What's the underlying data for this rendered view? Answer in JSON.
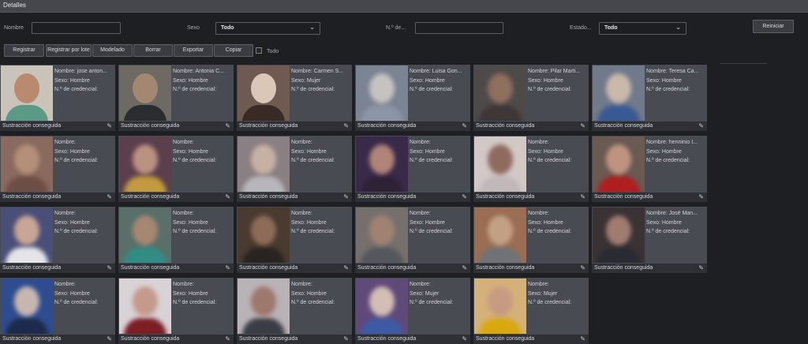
{
  "window": {
    "title": "Detalles"
  },
  "filters": {
    "name_label": "Nombre",
    "sex_label": "Sexo",
    "sex_value": "Todo",
    "credential_label": "N.º de...",
    "state_label": "Estado...",
    "state_value": "Todo",
    "reset_label": "Reiniciar"
  },
  "toolbar": {
    "register": "Registrar",
    "batch_register": "Registrar por lote",
    "modeling": "Modelado",
    "delete": "Borrar",
    "export": "Exportar",
    "copy": "Copiar",
    "all": "Todo"
  },
  "cards": [
    {
      "name": "Nombre: jose anton...",
      "sex": "Sexo: Hombre",
      "cred": "N.º de credencial:",
      "status": "Sustracción conseguida",
      "bg": "#c9c3ba",
      "face": "#b98a6e",
      "body": "#5b9a86",
      "blur": false
    },
    {
      "name": "Nombre: Antonia C...",
      "sex": "Sexo: Hombre",
      "cred": "N.º de credencial:",
      "status": "Sustracción conseguida",
      "bg": "#6d6a64",
      "face": "#a48770",
      "body": "#2a2c30",
      "blur": false
    },
    {
      "name": "Nombre: Carmen S...",
      "sex": "Sexo: Mujer",
      "cred": "N.º de credencial:",
      "status": "Sustracción conseguida",
      "bg": "#6e5a50",
      "face": "#d9c7b9",
      "body": "#3a2a26",
      "blur": false
    },
    {
      "name": "Nombre: Luisa Gon...",
      "sex": "Sexo: Hombre",
      "cred": "N.º de credencial:",
      "status": "Sustracción conseguida",
      "bg": "#7b8493",
      "face": "#c6c2c0",
      "body": "#8c95a5",
      "blur": true
    },
    {
      "name": "Nombre: Pilar Marti...",
      "sex": "Sexo: Hombre",
      "cred": "N.º de credencial:",
      "status": "Sustracción conseguida",
      "bg": "#4f4a4a",
      "face": "#8f6f5e",
      "body": "#3f3636",
      "blur": true
    },
    {
      "name": "Nombre: Teresa Ca...",
      "sex": "Sexo: Hombre",
      "cred": "N.º de credencial:",
      "status": "Sustracción conseguida",
      "bg": "#707a8a",
      "face": "#c9b9aa",
      "body": "#385a94",
      "blur": true
    },
    {
      "name": "Nombre:",
      "sex": "Sexo: Hombre",
      "cred": "N.º de credencial:",
      "status": "Sustracción conseguida",
      "bg": "#8a6a5e",
      "face": "#b48f7a",
      "body": "#6d4e46",
      "blur": true
    },
    {
      "name": "Nombre:",
      "sex": "Sexo: Hombre",
      "cred": "N.º de credencial:",
      "status": "Sustracción conseguida",
      "bg": "#5b3f4d",
      "face": "#bb9182",
      "body": "#c39a3d",
      "blur": true
    },
    {
      "name": "Nombre:",
      "sex": "Sexo: Hombre",
      "cred": "N.º de credencial:",
      "status": "Sustracción conseguida",
      "bg": "#8a7f82",
      "face": "#c7b1a4",
      "body": "#b7b6bb",
      "blur": true
    },
    {
      "name": "Nombre:",
      "sex": "Sexo: Hombre",
      "cred": "N.º de credencial:",
      "status": "Sustracción conseguida",
      "bg": "#3a2a4a",
      "face": "#b08478",
      "body": "#2d2236",
      "blur": true
    },
    {
      "name": "Nombre:",
      "sex": "Sexo: Hombre",
      "cred": "N.º de credencial:",
      "status": "Sustracción conseguida",
      "bg": "#d2c9c6",
      "face": "#8f6b5f",
      "body": "#c1b8ba",
      "blur": true
    },
    {
      "name": "Nombre: henninio I...",
      "sex": "Sexo: Hombre",
      "cred": "N.º de credencial:",
      "status": "Sustracción conseguida",
      "bg": "#6a5a52",
      "face": "#c09380",
      "body": "#b21d1f",
      "blur": true
    },
    {
      "name": "Nombre:",
      "sex": "Sexo: Hombre",
      "cred": "N.º de credencial:",
      "status": "Sustracción conseguida",
      "bg": "#4a4f78",
      "face": "#c9a596",
      "body": "#e5e4e8",
      "blur": true
    },
    {
      "name": "Nombre:",
      "sex": "Sexo: Hombre",
      "cred": "N.º de credencial:",
      "status": "Sustracción conseguida",
      "bg": "#5a6f6a",
      "face": "#a68772",
      "body": "#2f8d84",
      "blur": true
    },
    {
      "name": "Nombre:",
      "sex": "Sexo: Hombre",
      "cred": "N.º de credencial:",
      "status": "Sustracción conseguida",
      "bg": "#4a3a30",
      "face": "#8c6c56",
      "body": "#2a2420",
      "blur": true
    },
    {
      "name": "Nombre:",
      "sex": "Sexo: Hombre",
      "cred": "N.º de credencial:",
      "status": "Sustracción conseguida",
      "bg": "#76706d",
      "face": "#a18272",
      "body": "#55575e",
      "blur": true
    },
    {
      "name": "Nombre:",
      "sex": "Sexo: Hombre",
      "cred": "N.º de credencial:",
      "status": "Sustracción conseguida",
      "bg": "#9b6e53",
      "face": "#c3a084",
      "body": "#6f7276",
      "blur": true
    },
    {
      "name": "Nombre: José Man...",
      "sex": "Sexo: Hombre",
      "cred": "N.º de credencial:",
      "status": "Sustracción conseguida",
      "bg": "#3a3234",
      "face": "#9f7c6e",
      "body": "#2a2a33",
      "blur": true
    },
    {
      "name": "Nombre:",
      "sex": "Sexo: Hombre",
      "cred": "N.º de credencial:",
      "status": "Sustracción conseguida",
      "bg": "#2f4d8e",
      "face": "#c7b6b0",
      "body": "#1d2a4b",
      "blur": true
    },
    {
      "name": "Nombre:",
      "sex": "Sexo: Hombre",
      "cred": "N.º de credencial:",
      "status": "Sustracción conseguida",
      "bg": "#d9d2d6",
      "face": "#c49a8c",
      "body": "#7d1d24",
      "blur": true
    },
    {
      "name": "Nombre:",
      "sex": "Sexo: Hombre",
      "cred": "N.º de credencial:",
      "status": "Sustracción conseguida",
      "bg": "#b9b2b6",
      "face": "#9e786c",
      "body": "#3b3d46",
      "blur": true
    },
    {
      "name": "Nombre:",
      "sex": "Sexo: Mujer",
      "cred": "N.º de credencial:",
      "status": "Sustracción conseguida",
      "bg": "#5f4a7a",
      "face": "#d3bdb4",
      "body": "#3f5aa4",
      "blur": true
    },
    {
      "name": "Nombre:",
      "sex": "Sexo: Mujer",
      "cred": "N.º de credencial:",
      "status": "Sustracción conseguida",
      "bg": "#d5b17a",
      "face": "#c79b82",
      "body": "#d8a80e",
      "blur": true
    }
  ]
}
